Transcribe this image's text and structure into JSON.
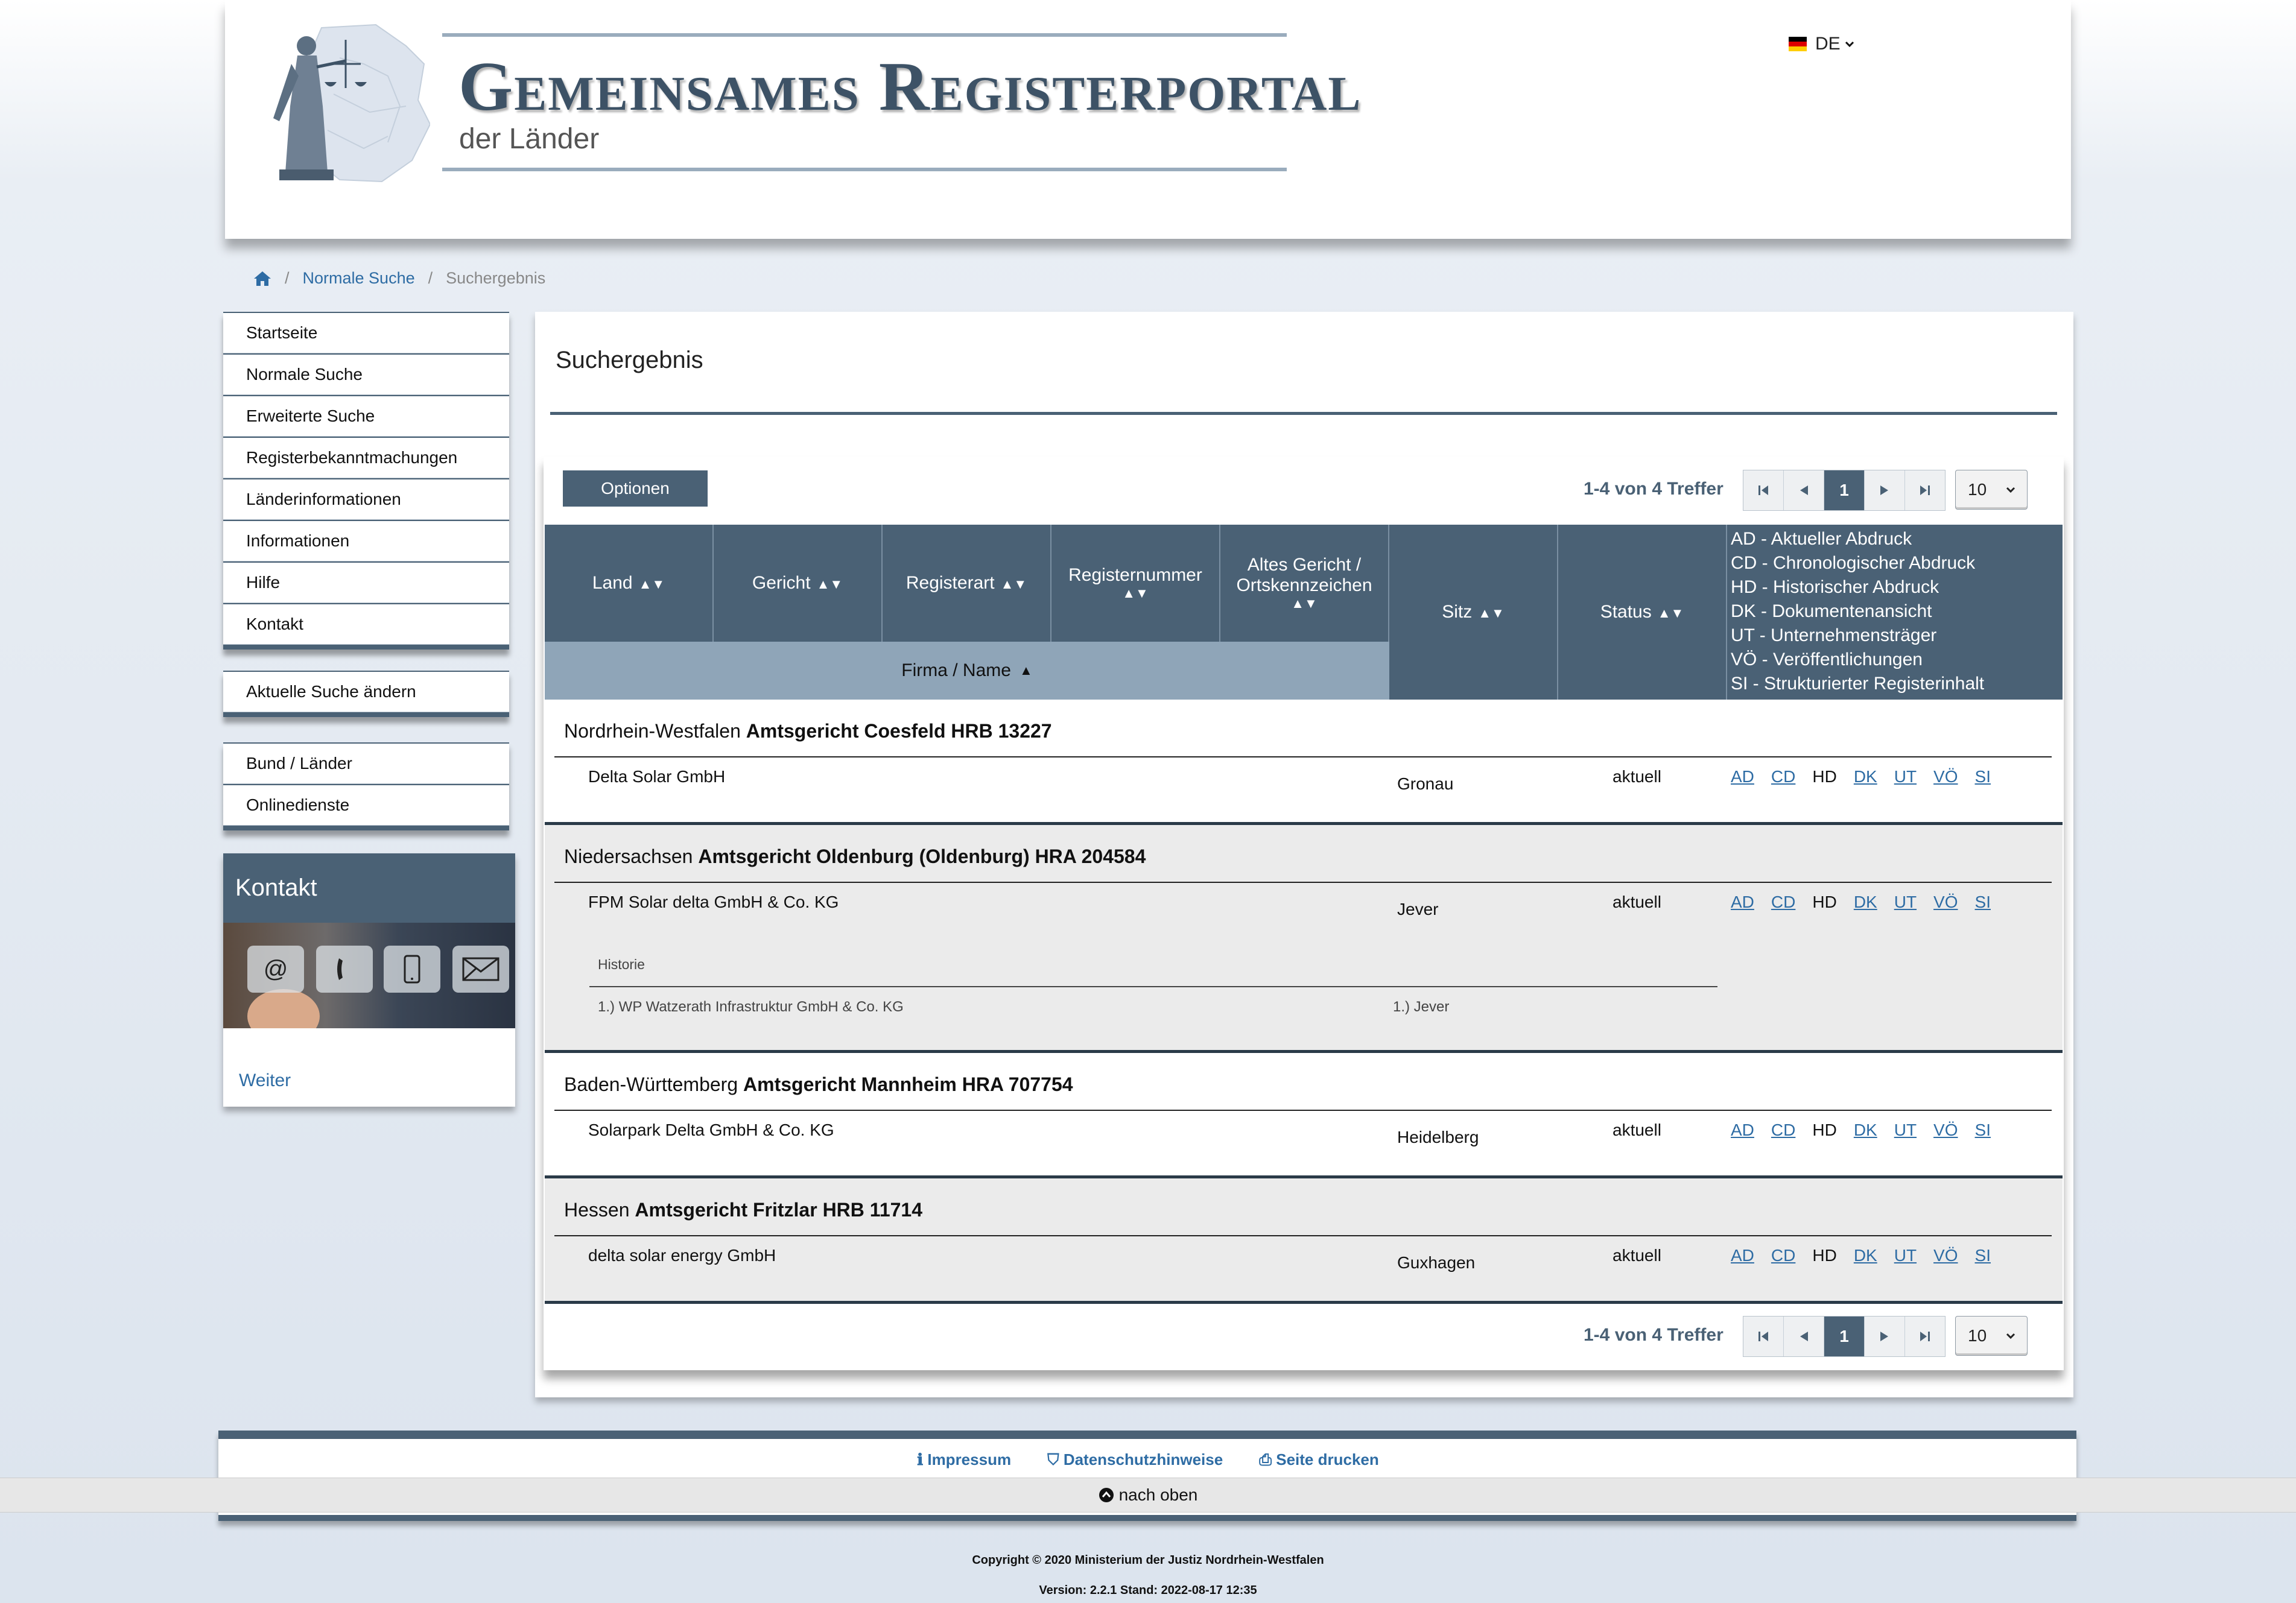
{
  "header": {
    "title": "Gemeinsames Registerportal",
    "subtitle": "der Länder",
    "language": "DE",
    "flag_colors": [
      "#000000",
      "#dd0000",
      "#ffce00"
    ]
  },
  "breadcrumb": {
    "home_icon": "home-icon",
    "items": [
      "Normale Suche",
      "Suchergebnis"
    ]
  },
  "sidebar": {
    "main_menu": [
      "Startseite",
      "Normale Suche",
      "Erweiterte Suche",
      "Registerbekanntmachungen",
      "Länderinformationen",
      "Informationen",
      "Hilfe",
      "Kontakt"
    ],
    "search_menu": [
      "Aktuelle Suche ändern"
    ],
    "extra_menu": [
      "Bund / Länder",
      "Onlinedienste"
    ],
    "kontakt": {
      "title": "Kontakt",
      "icons": [
        "at-icon",
        "phone-icon",
        "mobile-icon",
        "mail-icon"
      ],
      "at_glyph": "@",
      "link": "Weiter"
    }
  },
  "main": {
    "title": "Suchergebnis",
    "options_label": "Optionen",
    "hits": "1-4 von 4 Treffer",
    "current_page": "1",
    "page_size": "10",
    "columns": {
      "land": "Land",
      "gericht": "Gericht",
      "registerart": "Registerart",
      "registernummer": "Registernummer",
      "altes_gericht": "Altes Gericht / Ortskennzeichen",
      "sitz": "Sitz",
      "status": "Status",
      "firma": "Firma / Name"
    },
    "legend": [
      "AD - Aktueller Abdruck",
      "CD - Chronologischer Abdruck",
      "HD - Historischer Abdruck",
      "DK - Dokumentenansicht",
      "UT - Unternehmensträger",
      "VÖ - Veröffentlichungen",
      "SI - Strukturierter Registerinhalt"
    ],
    "doc_links": [
      "AD",
      "CD",
      "HD",
      "DK",
      "UT",
      "VÖ",
      "SI"
    ],
    "results": [
      {
        "land": "Nordrhein-Westfalen",
        "court": "Amtsgericht Coesfeld HRB 13227",
        "name": "Delta Solar GmbH",
        "sitz": "Gronau",
        "status": "aktuell"
      },
      {
        "land": "Niedersachsen",
        "court": "Amtsgericht Oldenburg (Oldenburg) HRA 204584",
        "name": "FPM Solar delta GmbH & Co. KG",
        "sitz": "Jever",
        "status": "aktuell",
        "history_label": "Historie",
        "history_name": "1.) WP Watzerath Infrastruktur GmbH & Co. KG",
        "history_sitz": "1.) Jever"
      },
      {
        "land": "Baden-Württemberg",
        "court": "Amtsgericht Mannheim HRA 707754",
        "name": "Solarpark Delta GmbH & Co. KG",
        "sitz": "Heidelberg",
        "status": "aktuell"
      },
      {
        "land": "Hessen",
        "court": "Amtsgericht Fritzlar HRB 11714",
        "name": "delta solar energy GmbH",
        "sitz": "Guxhagen",
        "status": "aktuell"
      }
    ]
  },
  "footer": {
    "impressum": "Impressum",
    "datenschutz": "Datenschutzhinweise",
    "drucken": "Seite drucken",
    "nach_oben": "nach oben",
    "copyright": "Copyright © 2020 Ministerium der Justiz Nordrhein-Westfalen",
    "version": "Version: 2.2.1 Stand: 2022-08-17 12:35"
  }
}
